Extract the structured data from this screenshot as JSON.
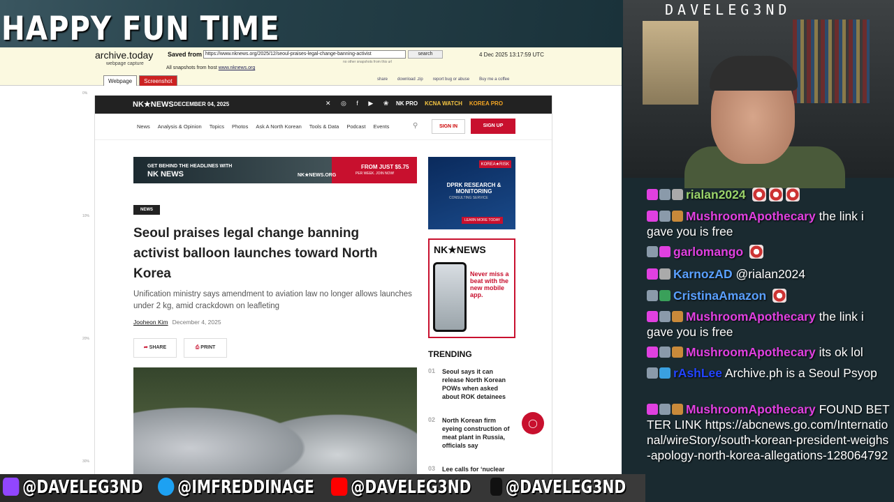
{
  "overlay": {
    "show_title": "HAPPY FUN TIME",
    "streamer_name": "DAVELEG3ND",
    "socials": [
      {
        "icon": "twitch-icon",
        "handle": "@DAVELEG3ND"
      },
      {
        "icon": "twitter-icon",
        "handle": "@IMFREDDINAGE"
      },
      {
        "icon": "youtube-icon",
        "handle": "@DAVELEG3ND"
      },
      {
        "icon": "tiktok-icon",
        "handle": "@DAVELEG3ND"
      }
    ]
  },
  "archive": {
    "site": "archive.today",
    "caption": "webpage capture",
    "saved_from_label": "Saved from",
    "url": "https://www.nknews.org/2025/12/seoul-praises-legal-change-banning-activist",
    "search_label": "search",
    "no_other": "no other snapshots from this url",
    "date": "4 Dec 2025 13:17:59 UTC",
    "all_snapshots": "All snapshots",
    "from_host": "from host",
    "host": "www.nknews.org",
    "tabs": [
      "Webpage",
      "Screenshot"
    ],
    "links": [
      "share",
      "download .zip",
      "report bug or abuse",
      "Buy me a coffee"
    ],
    "ruler": [
      "0%",
      "10%",
      "20%",
      "30%"
    ]
  },
  "nk": {
    "logo": "NK★NEWS",
    "date": "DECEMBER 04, 2025",
    "social_icons": "✕ ◎ f ▶ ❀",
    "pros": [
      "NK PRO",
      "KCNA WATCH",
      "KOREA PRO"
    ],
    "menu": [
      "News",
      "Analysis & Opinion",
      "Topics",
      "Photos",
      "Ask A North Korean",
      "Tools & Data",
      "Podcast",
      "Events"
    ],
    "signin": "SIGN IN",
    "signup": "SIGN UP",
    "ad_wide": {
      "line1": "GET BEHIND THE HEADLINES WITH",
      "line2": "NK NEWS",
      "logo": "NK★NEWS.ORG",
      "price": "FROM JUST $5.75",
      "per": "PER WEEK. JOIN NOW!"
    },
    "tag": "NEWS",
    "headline": "Seoul praises legal change banning activist balloon launches toward North Korea",
    "subhead": "Unification ministry says amendment to aviation law no longer allows launches under 2 kg, amid crackdown on leafleting",
    "author": "Jooheon Kim",
    "article_date": "December 4, 2025",
    "share": "SHARE",
    "print": "PRINT",
    "ad1": {
      "tag": "KOREA★RISK",
      "title": "DPRK RESEARCH & MONITORING",
      "sub": "CONSULTING SERVICE",
      "btn": "LEARN MORE TODAY"
    },
    "ad2": {
      "logo": "NK★NEWS",
      "msg": "Never miss a beat with the new mobile app."
    },
    "trending_title": "TRENDING",
    "trending": [
      {
        "n": "01",
        "t": "Seoul says it can release North Korean POWs when asked about ROK detainees"
      },
      {
        "n": "02",
        "t": "North Korean firm eyeing construction of meat plant in Russia, officials say"
      },
      {
        "n": "03",
        "t": "Lee calls for ‘nuclear"
      }
    ]
  },
  "chat": [
    {
      "user": "rialan2024",
      "color": "#9ad36a",
      "text": ""
    },
    {
      "user": "MushroomApothecary",
      "color": "#e040e0",
      "text": "the link i gave you is free"
    },
    {
      "user": "garlomango",
      "color": "#e040e0",
      "text": ""
    },
    {
      "user": "KarnozAD",
      "color": "#5aa0ff",
      "text": "@rialan2024"
    },
    {
      "user": "CristinaAmazon",
      "color": "#5aa0ff",
      "text": ""
    },
    {
      "user": "MushroomApothecary",
      "color": "#e040e0",
      "text": "the link i gave you is free"
    },
    {
      "user": "MushroomApothecary",
      "color": "#e040e0",
      "text": "its ok lol"
    },
    {
      "user": "rAshLee",
      "color": "#2244ff",
      "text": "Archive.ph is a Seoul Psyop"
    },
    {
      "user": "MushroomApothecary",
      "color": "#e040e0",
      "text": "FOUND BETTER LINK https://abcnews.go.com/International/wireStory/south-korean-president-weighs-apology-north-korea-allegations-128064792"
    }
  ]
}
